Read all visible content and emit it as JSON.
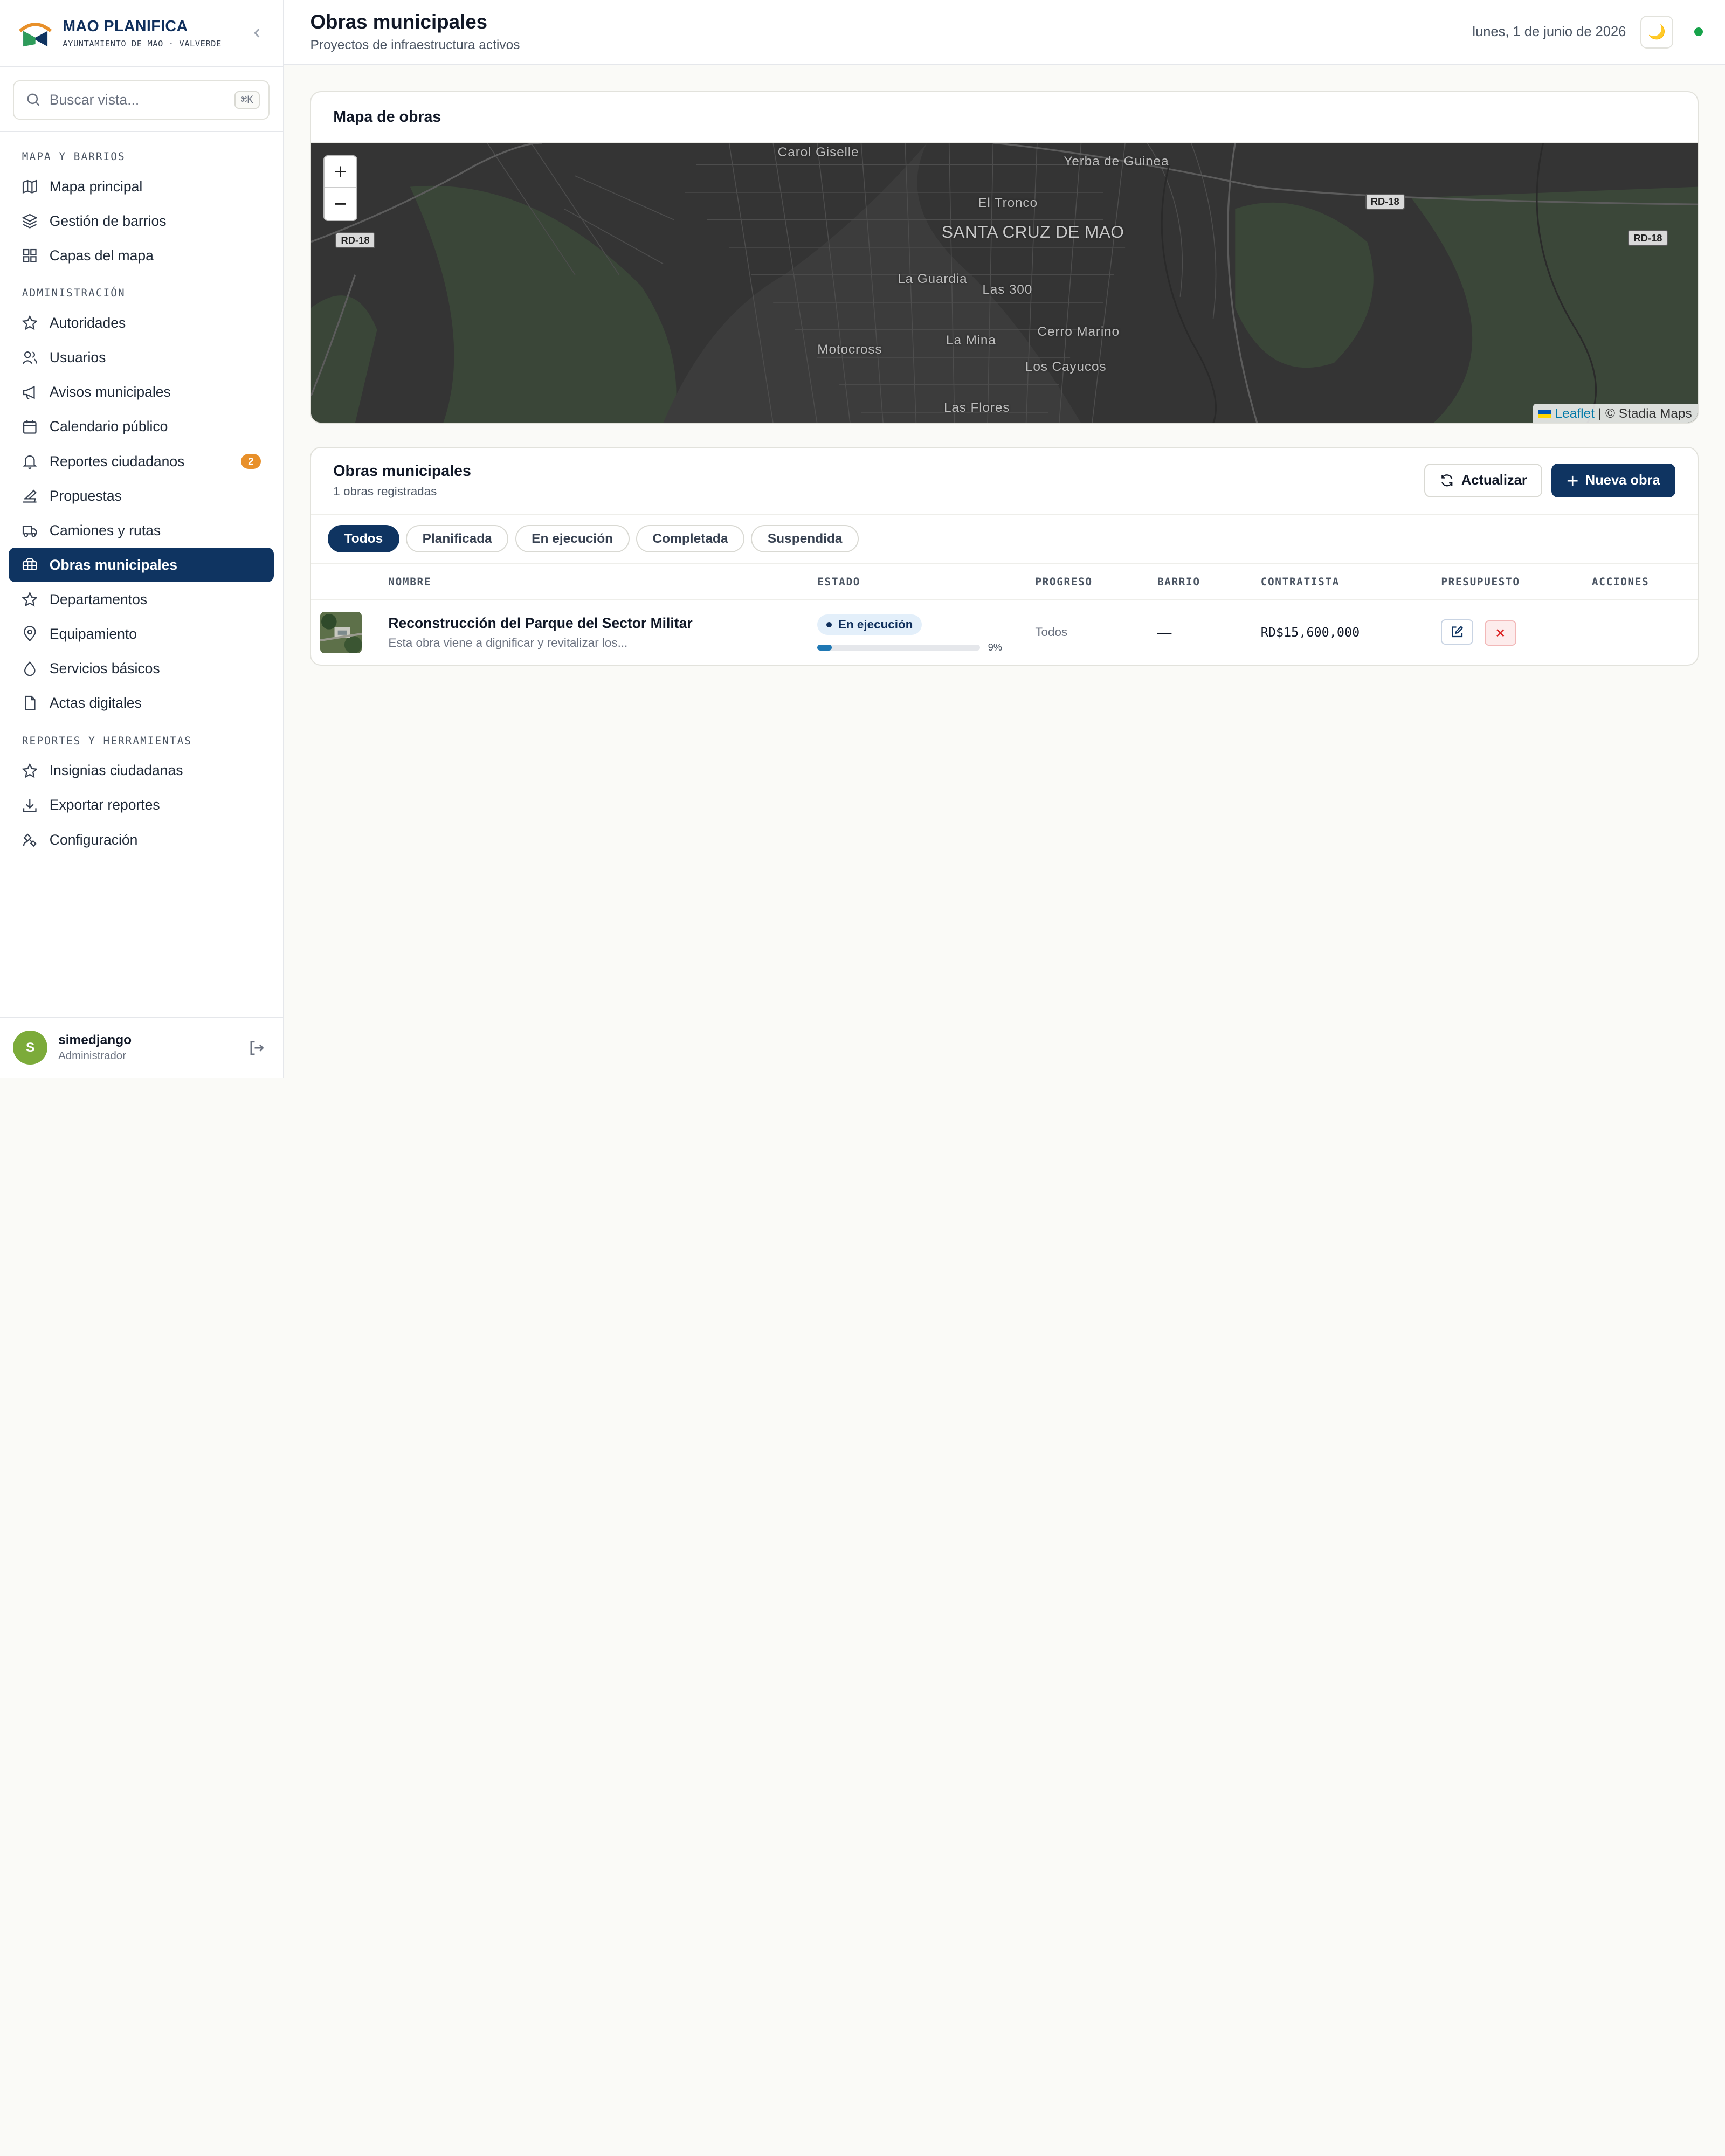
{
  "brand": {
    "name": "MAO PLANIFICA",
    "subtitle": "AYUNTAMIENTO DE MAO · VALVERDE"
  },
  "search": {
    "placeholder": "Buscar vista...",
    "shortcut": "⌘K"
  },
  "sidebar": {
    "sections": [
      {
        "title": "MAPA Y BARRIOS",
        "items": [
          {
            "label": "Mapa principal",
            "icon": "map-icon"
          },
          {
            "label": "Gestión de barrios",
            "icon": "layers-icon"
          },
          {
            "label": "Capas del mapa",
            "icon": "grid-icon"
          }
        ]
      },
      {
        "title": "ADMINISTRACIÓN",
        "items": [
          {
            "label": "Autoridades",
            "icon": "star-icon"
          },
          {
            "label": "Usuarios",
            "icon": "users-icon"
          },
          {
            "label": "Avisos municipales",
            "icon": "megaphone-icon"
          },
          {
            "label": "Calendario público",
            "icon": "calendar-icon"
          },
          {
            "label": "Reportes ciudadanos",
            "icon": "bell-icon",
            "badge": "2"
          },
          {
            "label": "Propuestas",
            "icon": "vote-icon"
          },
          {
            "label": "Camiones y rutas",
            "icon": "truck-icon"
          },
          {
            "label": "Obras municipales",
            "icon": "construction-icon",
            "active": true
          },
          {
            "label": "Departamentos",
            "icon": "star-icon"
          },
          {
            "label": "Equipamiento",
            "icon": "map-pin-icon"
          },
          {
            "label": "Servicios básicos",
            "icon": "droplet-icon"
          },
          {
            "label": "Actas digitales",
            "icon": "file-icon"
          }
        ]
      },
      {
        "title": "REPORTES Y HERRAMIENTAS",
        "items": [
          {
            "label": "Insignias ciudadanas",
            "icon": "star-icon"
          },
          {
            "label": "Exportar reportes",
            "icon": "download-icon"
          },
          {
            "label": "Configuración",
            "icon": "satellite-icon"
          }
        ]
      }
    ]
  },
  "user": {
    "initial": "S",
    "name": "simedjango",
    "role": "Administrador"
  },
  "header": {
    "title": "Obras municipales",
    "subtitle": "Proyectos de infraestructura activos",
    "date": "lunes, 1 de junio de 2026",
    "theme_icon": "🌙"
  },
  "map_card": {
    "title": "Mapa de obras",
    "zoom_in": "+",
    "zoom_out": "−",
    "attribution_link": "Leaflet",
    "attribution_rest": " | © Stadia Maps",
    "labels": {
      "city": "SANTA CRUZ DE MAO",
      "carol": "Carol Giselle",
      "yerba": "Yerba de Guinea",
      "tronco": "El Tronco",
      "guardia": "La Guardia",
      "las300": "Las 300",
      "cerro": "Cerro Marino",
      "mina": "La Mina",
      "motocross": "Motocross",
      "cayucos": "Los Cayucos",
      "flores": "Las Flores"
    },
    "road_shield": "RD-18"
  },
  "obras": {
    "title": "Obras municipales",
    "count_text": "1 obras registradas",
    "refresh_label": "Actualizar",
    "new_label": "Nueva obra",
    "filters": [
      "Todos",
      "Planificada",
      "En ejecución",
      "Completada",
      "Suspendida"
    ],
    "active_filter": "Todos",
    "columns": {
      "nombre": "NOMBRE",
      "estado": "ESTADO",
      "progreso": "PROGRESO",
      "barrio": "BARRIO",
      "contratista": "CONTRATISTA",
      "presupuesto": "PRESUPUESTO",
      "acciones": "ACCIONES"
    },
    "rows": [
      {
        "name": "Reconstrucción del Parque del Sector Militar",
        "description": "Esta obra viene a dignificar y revitalizar los...",
        "status": "En ejecución",
        "progress_pct": 9,
        "progress_label": "9%",
        "progreso": "Todos",
        "barrio": "—",
        "budget": "RD$15,600,000"
      }
    ]
  },
  "colors": {
    "navy": "#0f3461",
    "status_online": "#16a34a",
    "badge_orange": "#e8902a",
    "progress_blue": "#1f78b4",
    "map_bg": "#333333"
  }
}
